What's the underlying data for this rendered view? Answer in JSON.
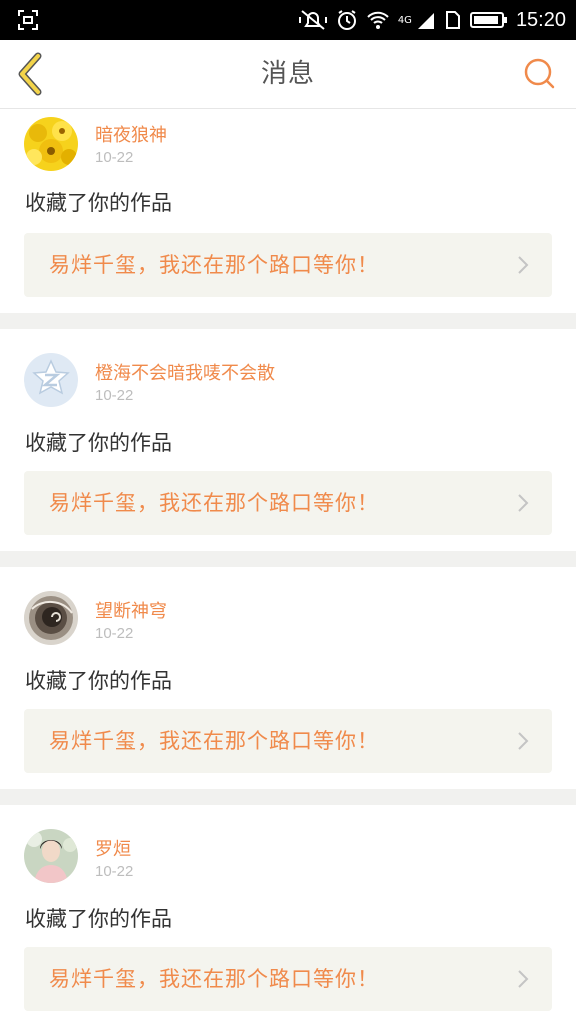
{
  "status_bar": {
    "time": "15:20",
    "network_type": "4G",
    "icons": [
      "screenshot-icon",
      "vibrate-mute-icon",
      "alarm-icon",
      "wifi-icon",
      "signal-icon",
      "sim-icon",
      "battery-icon"
    ]
  },
  "header": {
    "title": "消息",
    "back_icon": "back-chevron-icon",
    "search_icon": "search-icon"
  },
  "colors": {
    "accent": "#f08a4b",
    "back_icon": "#f3d44a",
    "work_bg": "#f4f4ee",
    "divider": "#f1f1ef"
  },
  "messages": [
    {
      "user": "暗夜狼神",
      "date": "10-22",
      "action": "收藏了你的作品",
      "work_title": "易烊千玺，我还在那个路口等你！",
      "avatar": "sunflower-avatar"
    },
    {
      "user": "橙海不会暗我唛不会散",
      "date": "10-22",
      "action": "收藏了你的作品",
      "work_title": "易烊千玺，我还在那个路口等你！",
      "avatar": "qzone-default-avatar"
    },
    {
      "user": "望断神穹",
      "date": "10-22",
      "action": "收藏了你的作品",
      "work_title": "易烊千玺，我还在那个路口等你！",
      "avatar": "spiral-avatar"
    },
    {
      "user": "罗烜",
      "date": "10-22",
      "action": "收藏了你的作品",
      "work_title": "易烊千玺，我还在那个路口等你！",
      "avatar": "portrait-avatar"
    }
  ]
}
